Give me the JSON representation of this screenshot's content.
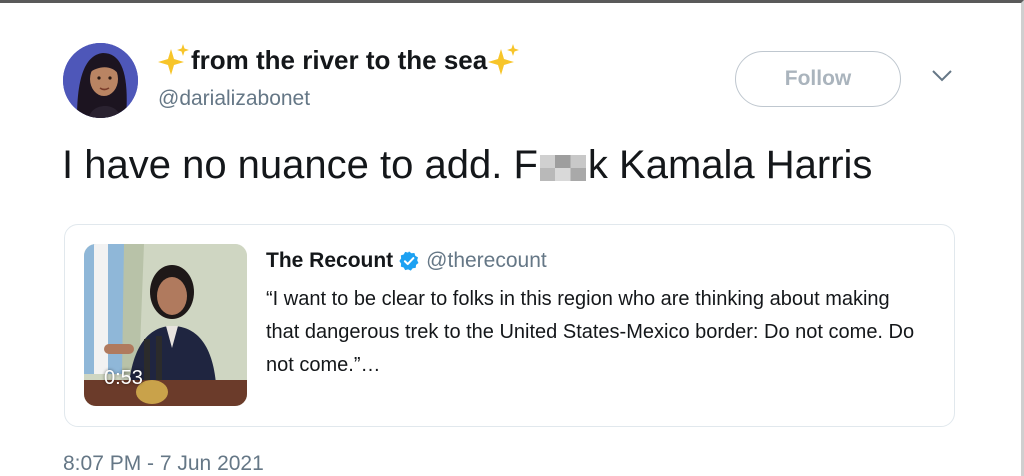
{
  "author": {
    "display_name": "from the river to the sea",
    "handle": "@darializabonet",
    "avatar_icon": "cartoon-woman-avatar",
    "name_emoji": "sparkles-icon"
  },
  "actions": {
    "follow_label": "Follow",
    "more_icon": "chevron-down-icon"
  },
  "tweet": {
    "text_before": "I have no nuance to add. F",
    "text_after": "k Kamala Harris",
    "timestamp": "8:07 PM - 7 Jun 2021"
  },
  "quoted": {
    "name": "The Recount",
    "handle": "@therecount",
    "verified_icon": "verified-badge-icon",
    "text": "“I want to be clear to folks in this region who are thinking about making that dangerous trek to the United States-Mexico border: Do not come. Do not come.”…",
    "video_duration": "0:53"
  },
  "colors": {
    "text": "#14171a",
    "secondary": "#657786",
    "verified": "#1da1f2",
    "border": "#e1e8ed",
    "follow_text": "#aab4bd"
  }
}
